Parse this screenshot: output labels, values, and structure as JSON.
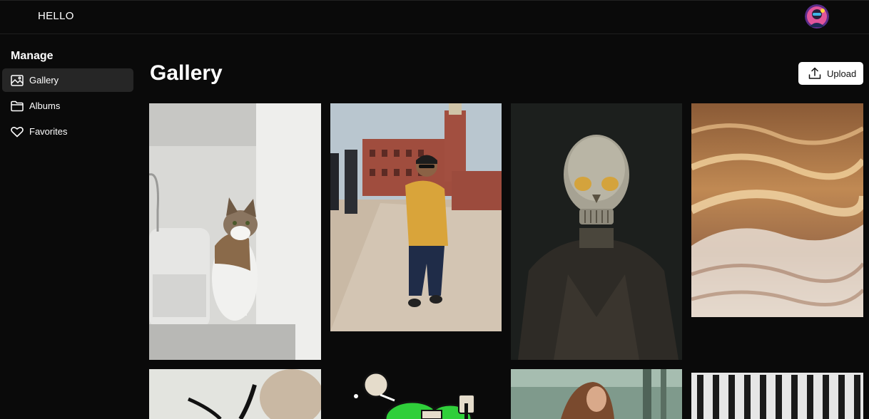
{
  "header": {
    "brand": "HELLO",
    "avatar_icon": "user-avatar"
  },
  "sidebar": {
    "title": "Manage",
    "items": [
      {
        "label": "Gallery",
        "icon": "image-icon",
        "active": true
      },
      {
        "label": "Albums",
        "icon": "folder-icon",
        "active": false
      },
      {
        "label": "Favorites",
        "icon": "heart-icon",
        "active": false
      }
    ]
  },
  "main": {
    "title": "Gallery",
    "upload_label": "Upload",
    "upload_icon": "upload-icon",
    "photos": [
      "cat",
      "man-yellow-jacket",
      "skull-head",
      "ocean-wave",
      "antelope-horns",
      "cartoon-character",
      "forest-girl",
      "striped-pattern"
    ]
  },
  "colors": {
    "background": "#0a0a0a",
    "active_item": "#262626",
    "button_bg": "#ffffff"
  }
}
